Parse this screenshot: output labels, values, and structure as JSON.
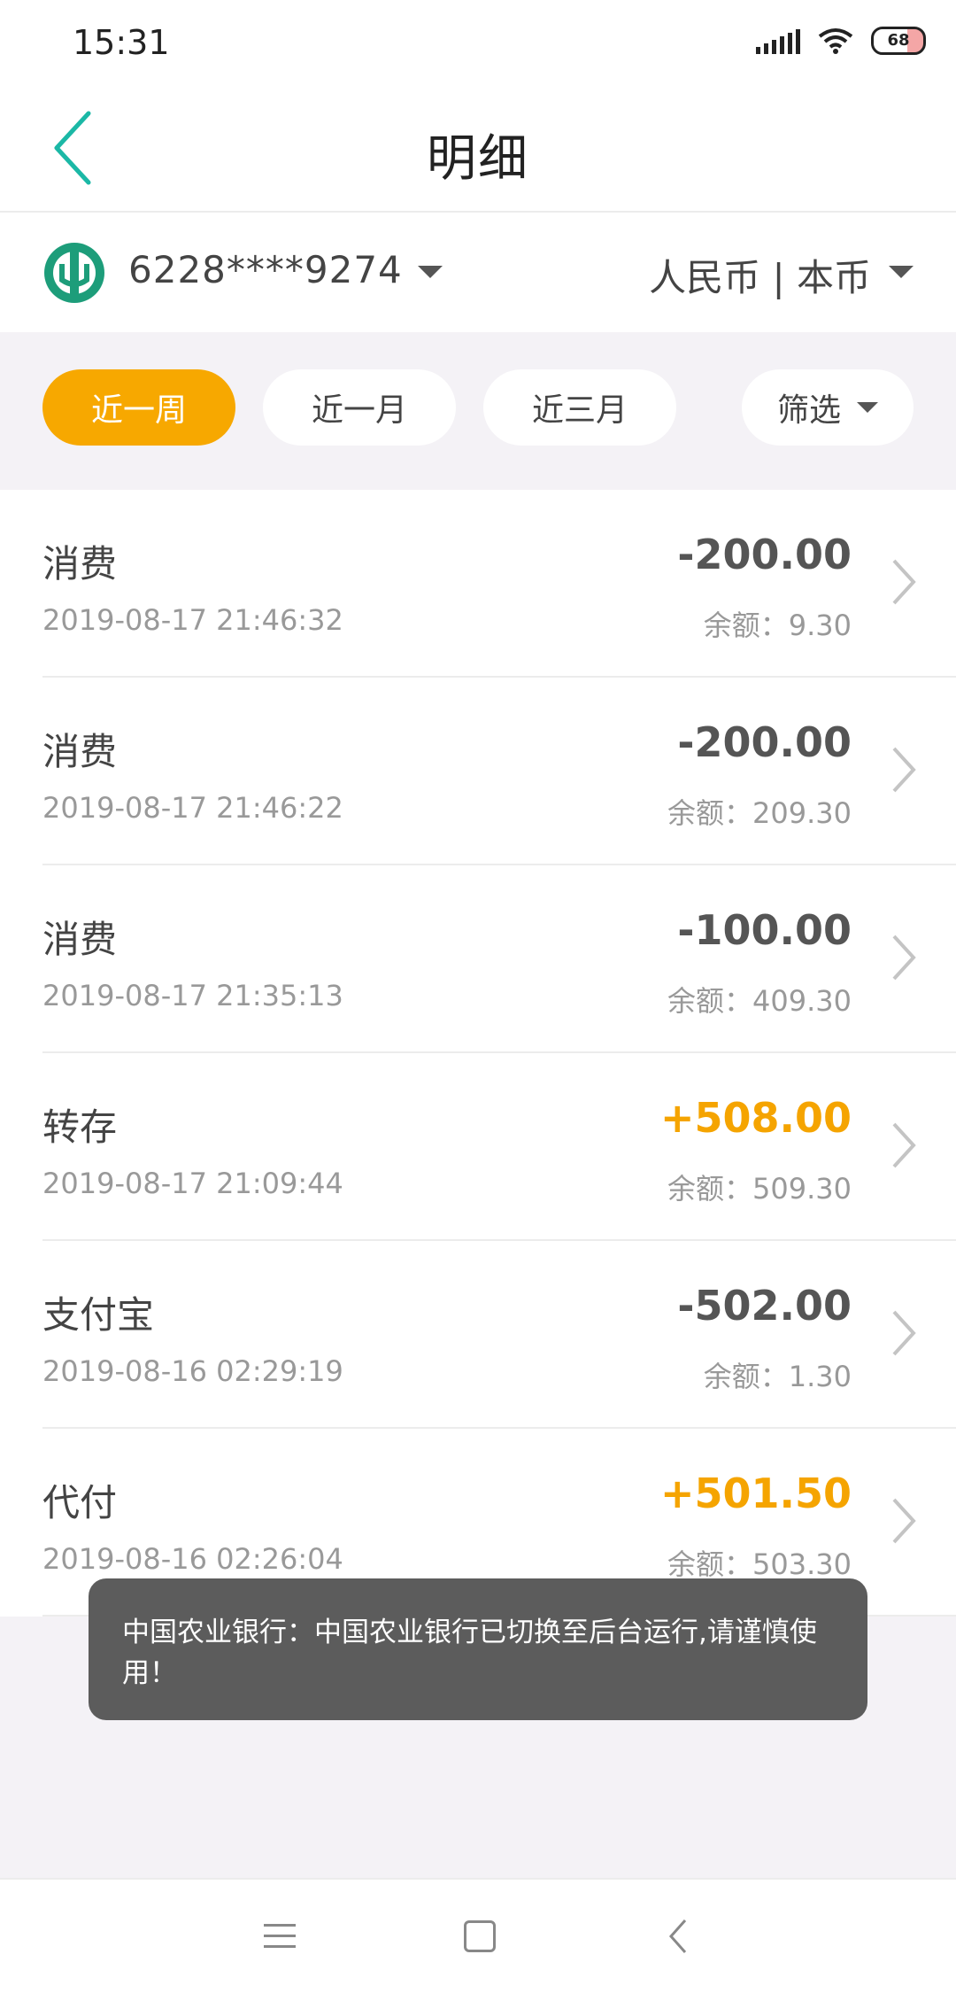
{
  "status_bar": {
    "time": "15:31",
    "battery": "68"
  },
  "header": {
    "title": "明细",
    "accent_color": "#1bb8a6"
  },
  "account": {
    "card_number": "6228****9274",
    "currency": "人民币 | 本币",
    "logo_icon": "abc-bank-logo-icon"
  },
  "filters": {
    "active_color": "#f7a800",
    "chips": [
      {
        "label": "近一周",
        "active": true
      },
      {
        "label": "近一月",
        "active": false
      },
      {
        "label": "近三月",
        "active": false
      }
    ],
    "filter_label": "筛选"
  },
  "transactions": [
    {
      "type": "消费",
      "time": "2019-08-17 21:46:32",
      "amount": "-200.00",
      "balance": "余额：9.30",
      "positive": false
    },
    {
      "type": "消费",
      "time": "2019-08-17 21:46:22",
      "amount": "-200.00",
      "balance": "余额：209.30",
      "positive": false
    },
    {
      "type": "消费",
      "time": "2019-08-17 21:35:13",
      "amount": "-100.00",
      "balance": "余额：409.30",
      "positive": false
    },
    {
      "type": "转存",
      "time": "2019-08-17 21:09:44",
      "amount": "+508.00",
      "balance": "余额：509.30",
      "positive": true
    },
    {
      "type": "支付宝",
      "time": "2019-08-16 02:29:19",
      "amount": "-502.00",
      "balance": "余额：1.30",
      "positive": false
    },
    {
      "type": "代付",
      "time": "2019-08-16 02:26:04",
      "amount": "+501.50",
      "balance": "余额：503.30",
      "positive": true
    }
  ],
  "toast": {
    "message": "中国农业银行：中国农业银行已切换至后台运行,请谨慎使用！"
  },
  "colors": {
    "positive_amount": "#f5a400",
    "negative_amount": "#555555"
  }
}
